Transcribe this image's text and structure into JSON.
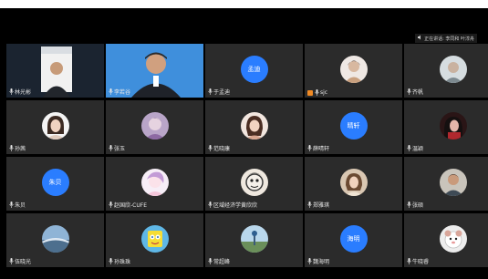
{
  "colors": {
    "background_black": "#000000",
    "tile_gray": "#2b2b2b",
    "avatar_blue": "#2a7dff",
    "label_white": "#e8e8e8"
  },
  "tooltip": {
    "text": "正在讲话: 李同和  叶淳舟",
    "icon": "speaker-icon"
  },
  "participants": [
    {
      "id": "p1",
      "name": "林光彬",
      "avatar_type": "video"
    },
    {
      "id": "p2",
      "name": "李若谷",
      "avatar_type": "video"
    },
    {
      "id": "p3",
      "name": "于孟迪",
      "avatar_type": "initials",
      "initials": "孟迪"
    },
    {
      "id": "p4",
      "name": "sjc",
      "avatar_type": "photo",
      "host_badge": true
    },
    {
      "id": "p5",
      "name": "齐帆",
      "avatar_type": "photo"
    },
    {
      "id": "p6",
      "name": "孙茜",
      "avatar_type": "photo"
    },
    {
      "id": "p7",
      "name": "张玉",
      "avatar_type": "photo"
    },
    {
      "id": "p8",
      "name": "范晓康",
      "avatar_type": "photo"
    },
    {
      "id": "p9",
      "name": "薛晴轩",
      "avatar_type": "initials",
      "initials": "晴轩"
    },
    {
      "id": "p10",
      "name": "温颖",
      "avatar_type": "photo"
    },
    {
      "id": "p11",
      "name": "朱贝",
      "avatar_type": "initials",
      "initials": "朱贝"
    },
    {
      "id": "p12",
      "name": "赵国欣-CUFE",
      "avatar_type": "photo"
    },
    {
      "id": "p13",
      "name": "区域经济学黄欣欣",
      "avatar_type": "photo"
    },
    {
      "id": "p14",
      "name": "郑雅琪",
      "avatar_type": "photo"
    },
    {
      "id": "p15",
      "name": "张硕",
      "avatar_type": "photo"
    },
    {
      "id": "p16",
      "name": "伍晓光",
      "avatar_type": "photo"
    },
    {
      "id": "p17",
      "name": "孙珠珠",
      "avatar_type": "photo"
    },
    {
      "id": "p18",
      "name": "常超峰",
      "avatar_type": "photo"
    },
    {
      "id": "p19",
      "name": "魏海明",
      "avatar_type": "initials",
      "initials": "海明"
    },
    {
      "id": "p20",
      "name": "牛晓睿",
      "avatar_type": "photo"
    }
  ]
}
